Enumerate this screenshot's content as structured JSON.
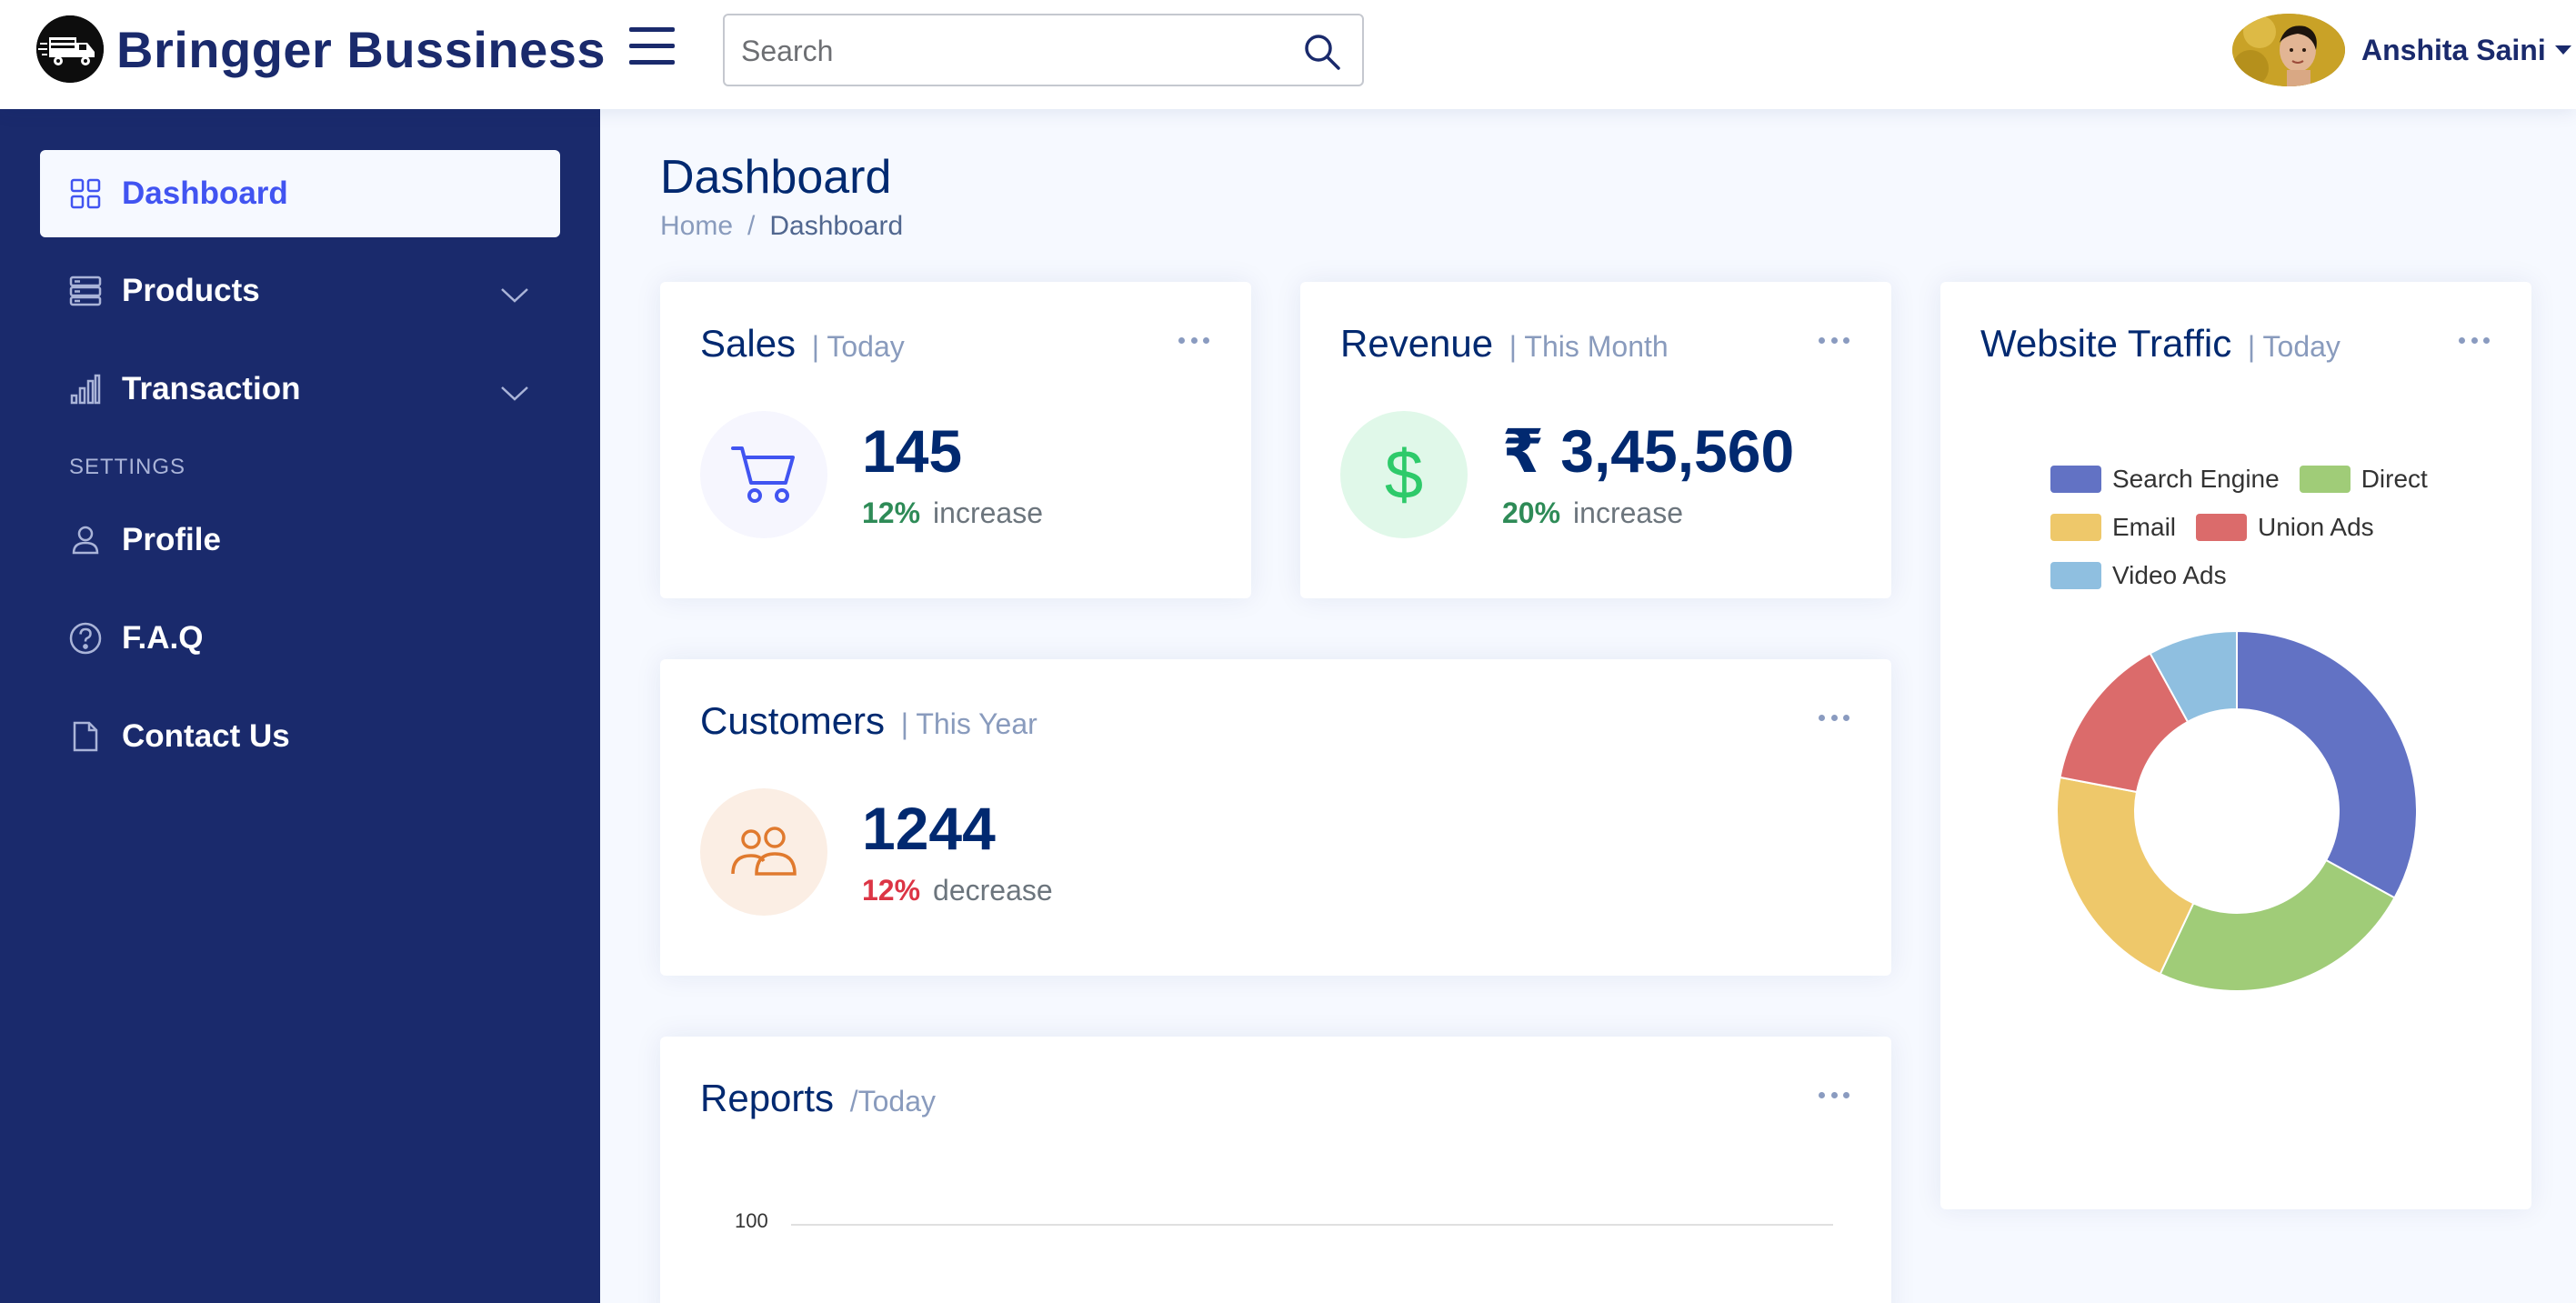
{
  "header": {
    "brand": "Bringger Bussiness",
    "search_placeholder": "Search",
    "user_name": "Anshita Saini"
  },
  "sidebar": {
    "items": [
      {
        "label": "Dashboard",
        "icon": "grid-icon",
        "active": true
      },
      {
        "label": "Products",
        "icon": "products-icon",
        "expandable": true
      },
      {
        "label": "Transaction",
        "icon": "bar-chart-icon",
        "expandable": true
      }
    ],
    "settings_heading": "SETTINGS",
    "settings_items": [
      {
        "label": "Profile",
        "icon": "person-icon"
      },
      {
        "label": "F.A.Q",
        "icon": "question-circle-icon"
      },
      {
        "label": "Contact Us",
        "icon": "file-icon"
      }
    ]
  },
  "page": {
    "title": "Dashboard",
    "breadcrumb": {
      "home": "Home",
      "separator": "/",
      "current": "Dashboard"
    }
  },
  "cards": {
    "sales": {
      "title": "Sales",
      "period": "| Today",
      "value": "145",
      "change_pct": "12%",
      "change_label": "increase",
      "trend": "up"
    },
    "revenue": {
      "title": "Revenue",
      "period": "| This Month",
      "value": "₹ 3,45,560",
      "change_pct": "20%",
      "change_label": "increase",
      "trend": "up"
    },
    "customers": {
      "title": "Customers",
      "period": "| This Year",
      "value": "1244",
      "change_pct": "12%",
      "change_label": "decrease",
      "trend": "down"
    },
    "traffic": {
      "title": "Website Traffic",
      "period": "| Today"
    },
    "reports": {
      "title": "Reports",
      "period": "/Today",
      "y_tick": "100"
    }
  },
  "colors": {
    "navy": "#1a2a6c",
    "accent": "#4154f1",
    "increase": "#2e8b57",
    "decrease": "#dc3545"
  },
  "chart_data": {
    "type": "pie",
    "title": "Website Traffic | Today",
    "donut": true,
    "legend_position": "top",
    "categories": [
      "Search Engine",
      "Direct",
      "Email",
      "Union Ads",
      "Video Ads"
    ],
    "values": [
      33,
      24,
      21,
      14,
      8
    ],
    "colors": [
      "#6272c4",
      "#a0cc78",
      "#eec86a",
      "#db6b6b",
      "#8fbfe0"
    ]
  }
}
